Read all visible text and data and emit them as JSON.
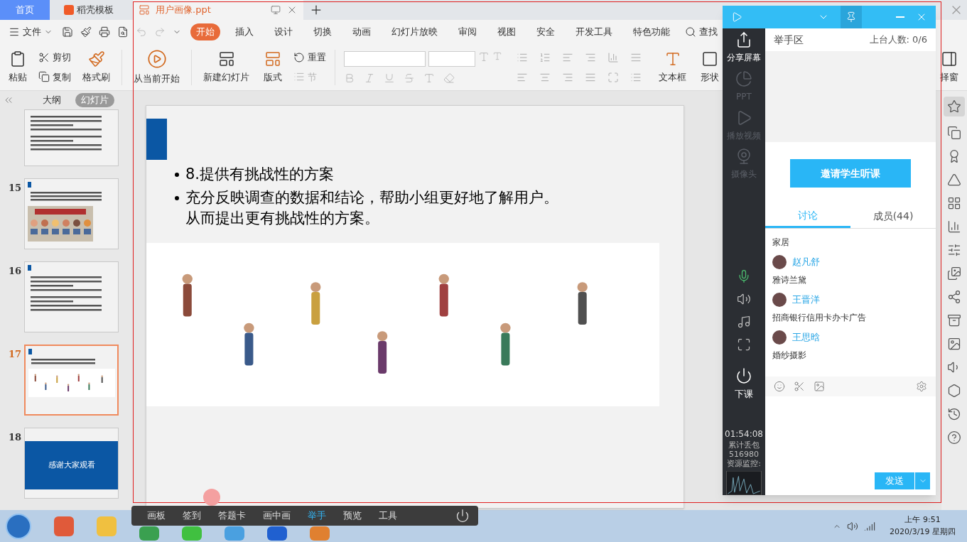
{
  "app_tabs": [
    {
      "label": "首页",
      "selected": true
    },
    {
      "label": "稻壳模板",
      "selected": false
    }
  ],
  "document_tab": {
    "title": "用户画像.ppt"
  },
  "file_menu": "文件",
  "ribbon_tabs": [
    {
      "label": "开始",
      "selected": true
    },
    {
      "label": "插入",
      "selected": false
    },
    {
      "label": "设计",
      "selected": false
    },
    {
      "label": "切换",
      "selected": false
    },
    {
      "label": "动画",
      "selected": false
    },
    {
      "label": "幻灯片放映",
      "selected": false
    },
    {
      "label": "审阅",
      "selected": false
    },
    {
      "label": "视图",
      "selected": false
    },
    {
      "label": "安全",
      "selected": false
    },
    {
      "label": "开发工具",
      "selected": false
    },
    {
      "label": "特色功能",
      "selected": false
    }
  ],
  "search": "查找",
  "ribbon": {
    "paste": "粘贴",
    "cut": "剪切",
    "copy": "复制",
    "format_painter": "格式刷",
    "play_from_current": "从当前开始",
    "new_slide": "新建幻灯片",
    "layout": "版式",
    "reset": "重置",
    "section": {
      "label": "节",
      "disabled": true
    },
    "text_box": "文本框",
    "shape": "形状",
    "selection_pane": "择窗"
  },
  "outline_tabs": [
    {
      "label": "大纲",
      "selected": false
    },
    {
      "label": "幻灯片",
      "selected": true
    }
  ],
  "slides": [
    {
      "kind": "text",
      "selected": false
    },
    {
      "number": "15",
      "kind": "persona",
      "selected": false
    },
    {
      "number": "16",
      "kind": "text",
      "selected": false
    },
    {
      "number": "17",
      "kind": "crowd",
      "selected": true
    },
    {
      "number": "18",
      "kind": "title",
      "title": "感谢大家观看",
      "selected": false
    }
  ],
  "slide": {
    "bullets": [
      {
        "lines": [
          "8.提供有挑战性的方案"
        ]
      },
      {
        "lines": [
          "充分反映调查的数据和结论，帮助小组更好地了解用户。",
          "从而提出更有挑战性的方案。"
        ]
      }
    ]
  },
  "class_panel": {
    "left_items": [
      {
        "label": "分享屏幕",
        "disabled": false
      },
      {
        "label": "PPT",
        "disabled": true
      },
      {
        "label": "播放视频",
        "disabled": true
      },
      {
        "label": "摄像头",
        "disabled": true
      }
    ],
    "end_class": "下课",
    "timer": "01:54:08",
    "stats": [
      "累计丢包",
      "516980",
      "资源监控:"
    ],
    "hand_raise_title": "举手区",
    "stage_count": "上台人数: 0/6",
    "invite_button": "邀请学生听课",
    "tabs": [
      {
        "label": "讨论",
        "selected": true
      },
      {
        "label": "成员(44)",
        "selected": false
      }
    ],
    "messages": [
      {
        "text": "家居"
      },
      {
        "name": "赵凡舒",
        "text": "雅诗兰黛"
      },
      {
        "name": "王晋洋",
        "text": "招商银行信用卡办卡广告"
      },
      {
        "name": "王思晗",
        "text": "婚纱摄影"
      }
    ],
    "send": "发送"
  },
  "bottom_toolbar": [
    {
      "label": "画板",
      "selected": false
    },
    {
      "label": "签到",
      "selected": false
    },
    {
      "label": "答题卡",
      "selected": false
    },
    {
      "label": "画中画",
      "selected": false
    },
    {
      "label": "举手",
      "selected": true
    },
    {
      "label": "预览",
      "selected": false
    },
    {
      "label": "工具",
      "selected": false
    }
  ],
  "clock": {
    "time": "上午 9:51",
    "date": "2020/3/19 星期四"
  }
}
